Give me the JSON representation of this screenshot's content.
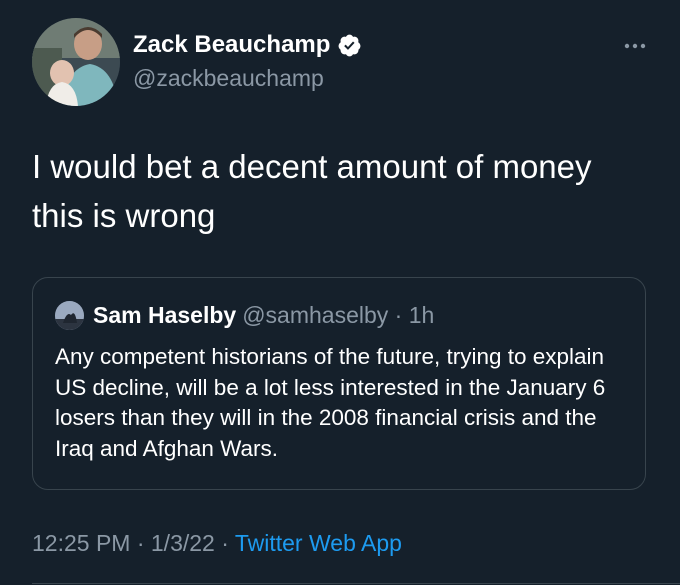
{
  "colors": {
    "background": "#15202b",
    "text_primary": "#ffffff",
    "text_secondary": "#8b98a5",
    "accent": "#1d9bf0",
    "border": "#38444d"
  },
  "author": {
    "name": "Zack Beauchamp",
    "handle": "@zackbeauchamp",
    "verified_icon": "verified-badge-icon",
    "avatar_icon": "avatar"
  },
  "more_icon": "more-horizontal-icon",
  "tweet": {
    "text": "I would bet a decent amount of money this is wrong"
  },
  "quoted_tweet": {
    "name": "Sam Haselby",
    "handle_time": "@samhaselby · 1h",
    "text": "Any competent historians of the future, trying to explain US decline, will be a lot less interested in the January 6 losers than they will in the 2008 financial crisis and the Iraq and Afghan Wars."
  },
  "meta": {
    "timestamp": "12:25 PM · 1/3/22 · ",
    "source": "Twitter Web App"
  }
}
